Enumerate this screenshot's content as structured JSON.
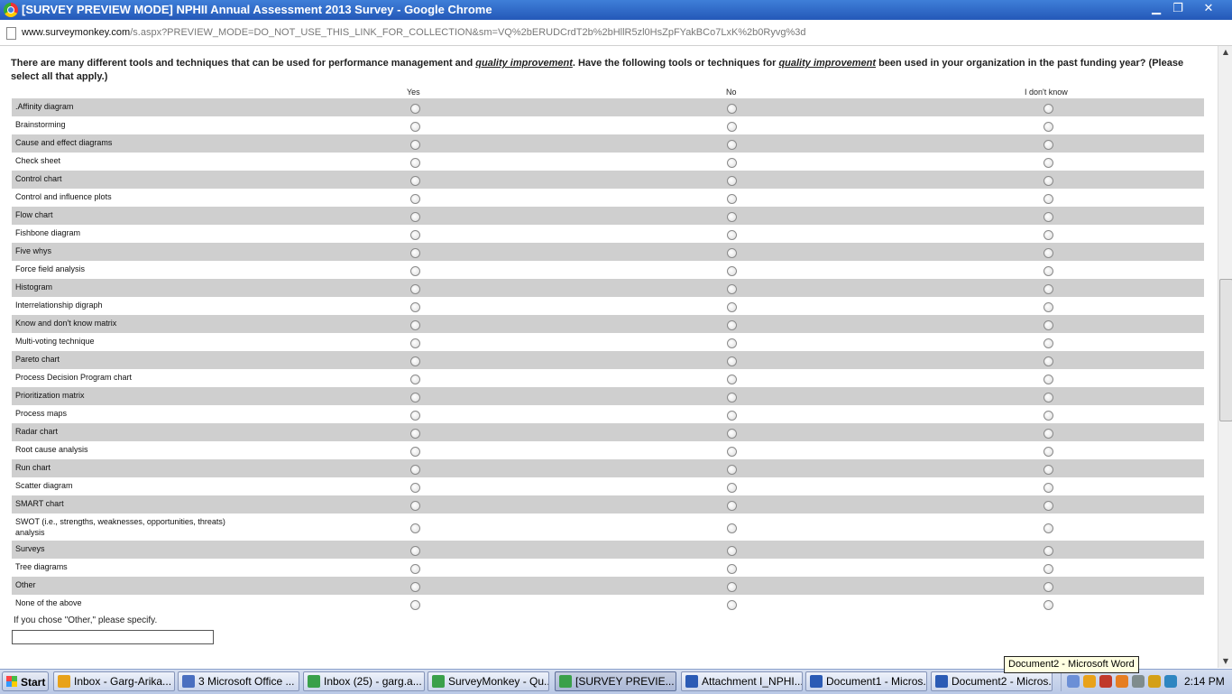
{
  "window": {
    "title": "[SURVEY PREVIEW MODE] NPHII Annual Assessment 2013 Survey - Google Chrome",
    "controls": {
      "minimize": "▁",
      "maximize": "❐",
      "close": "✕"
    }
  },
  "address_bar": {
    "host": "www.surveymonkey.com",
    "path": "/s.aspx?PREVIEW_MODE=DO_NOT_USE_THIS_LINK_FOR_COLLECTION&sm=VQ%2bERUDCrdT2b%2bHllR5zl0HsZpFYakBCo7LxK%2b0Ryvg%3d"
  },
  "question": {
    "part1": "There are many different tools and techniques that can be used for performance management and ",
    "em1": "quality improvement",
    "part2": ". Have the following tools or techniques for ",
    "em2": "quality improvement",
    "part3": " been used in your organization in the past funding year? (Please select all that apply.)"
  },
  "columns": [
    "Yes",
    "No",
    "I don't know"
  ],
  "rows": [
    ".Affinity diagram",
    "Brainstorming",
    "Cause and effect diagrams",
    "Check sheet",
    "Control chart",
    "Control and influence plots",
    "Flow chart",
    "Fishbone diagram",
    "Five whys",
    "Force field analysis",
    "Histogram",
    "Interrelationship digraph",
    "Know and don't know matrix",
    "Multi-voting technique",
    "Pareto chart",
    "Process Decision Program chart",
    "Prioritization matrix",
    "Process maps",
    "Radar chart",
    "Root cause analysis",
    "Run chart",
    "Scatter diagram",
    "SMART chart",
    "SWOT (i.e., strengths, weaknesses, opportunities, threats) analysis",
    "Surveys",
    "Tree diagrams",
    "Other",
    "None of the above"
  ],
  "other_specify": {
    "label": "If you chose \"Other,\" please specify.",
    "value": ""
  },
  "scrollbar": {
    "up": "▲",
    "down": "▼"
  },
  "tooltip": "Document2 - Microsoft Word",
  "taskbar": {
    "start_label": "Start",
    "tasks": [
      {
        "label": "Inbox - Garg-Arika...",
        "icon": "outlook-icon",
        "color": "#e8a21a"
      },
      {
        "label": "3 Microsoft Office ...",
        "icon": "office-group-icon",
        "color": "#4a6fc0"
      },
      {
        "label": "Inbox (25) - garg.a...",
        "icon": "chrome-icon",
        "color": "#3aa04a"
      },
      {
        "label": "SurveyMonkey - Qu...",
        "icon": "chrome-icon",
        "color": "#3aa04a"
      },
      {
        "label": "[SURVEY PREVIE...",
        "icon": "chrome-icon",
        "color": "#3aa04a",
        "active": true
      },
      {
        "label": "Attachment I_NPHI...",
        "icon": "word-icon",
        "color": "#2b5bb5"
      },
      {
        "label": "Document1 - Micros...",
        "icon": "word-icon",
        "color": "#2b5bb5"
      },
      {
        "label": "Document2 - Micros...",
        "icon": "word-icon",
        "color": "#2b5bb5"
      }
    ],
    "clock": "2:14 PM"
  }
}
